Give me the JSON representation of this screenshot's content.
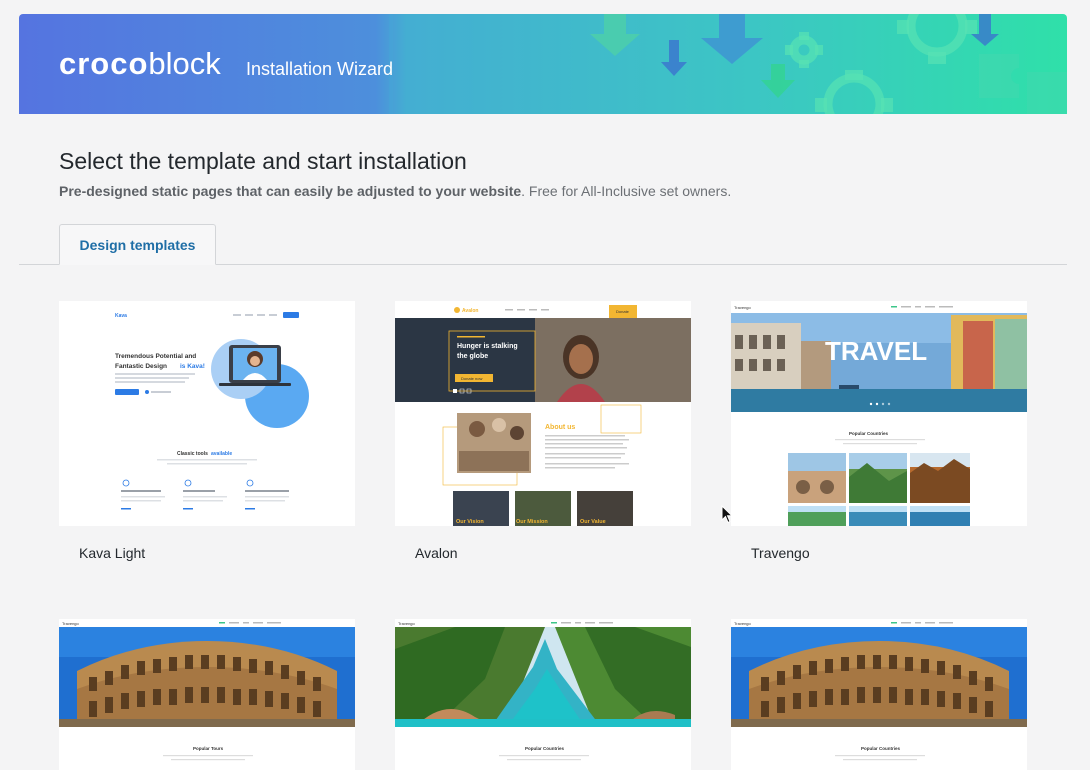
{
  "header": {
    "logo_text_bold": "croco",
    "logo_text_light": "block",
    "wizard_title": "Installation Wizard"
  },
  "main": {
    "title": "Select the template and start installation",
    "subtitle_bold": "Pre-designed static pages that can easily be adjusted to your website",
    "subtitle_rest": ". Free for All-Inclusive set owners."
  },
  "tabs": [
    {
      "label": "Design templates",
      "active": true
    }
  ],
  "templates": [
    {
      "name": "Kava Light",
      "preview": {
        "logo": "Kava",
        "headline_1": "Tremendous Potential and",
        "headline_2": "Fantastic Design",
        "headline_accent": "is Kava!",
        "section_title": "Classic tools",
        "section_accent": "available"
      }
    },
    {
      "name": "Avalon",
      "preview": {
        "logo": "Avalon",
        "cta": "Donate",
        "hero_text_1": "Hunger is stalking",
        "hero_text_2": "the globe",
        "hero_button": "Donate now",
        "about_title": "About us",
        "tile_1": "Our Vision",
        "tile_2": "Our Mission",
        "tile_3": "Our Value"
      }
    },
    {
      "name": "Travengo",
      "preview": {
        "logo": "Travengo",
        "hero_text": "TRAVEL",
        "section_title": "Popular Countries"
      }
    },
    {
      "name": "",
      "preview": {
        "logo": "Travengo",
        "section_title": "Popular Tours"
      }
    },
    {
      "name": "",
      "preview": {
        "logo": "Travengo",
        "section_title": "Popular Countries"
      }
    },
    {
      "name": "",
      "preview": {
        "logo": "Travengo",
        "section_title": "Popular Countries"
      }
    }
  ],
  "colors": {
    "accent_blue": "#1f6ea6",
    "avalon_yellow": "#f2b632",
    "kava_blue": "#2c7be5",
    "banner_start": "#5574e0",
    "banner_end": "#2fe0a9"
  }
}
